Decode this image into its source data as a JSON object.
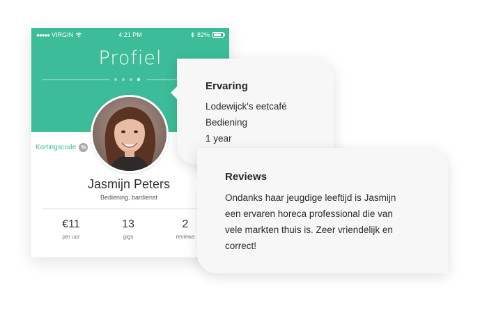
{
  "status_bar": {
    "signal": "●●●●●",
    "carrier": "VIRGIN",
    "time": "4:21 PM",
    "battery": "82%",
    "battery_level": 0.82
  },
  "header": {
    "title": "Profiel",
    "pager": {
      "count": 4,
      "active_index": 3
    },
    "color": "#3cbc98"
  },
  "profile": {
    "discount_label": "Kortingscode",
    "discount_icon": "%",
    "name": "Jasmijn Peters",
    "role": "Bediening, bardienst"
  },
  "stats": [
    {
      "value": "€11",
      "label": "per uur"
    },
    {
      "value": "13",
      "label": "gigs"
    },
    {
      "value": "2",
      "label": "reviews"
    }
  ],
  "experience": {
    "title": "Ervaring",
    "lines": [
      "Lodewijck's eetcafé",
      "Bediening",
      "1 year"
    ]
  },
  "reviews": {
    "title": "Reviews",
    "lines": [
      "Ondanks haar jeugdige leeftijd is Jasmijn",
      "een ervaren horeca professional die van",
      "vele markten thuis is. Zeer vriendelijk en",
      "correct!"
    ]
  }
}
